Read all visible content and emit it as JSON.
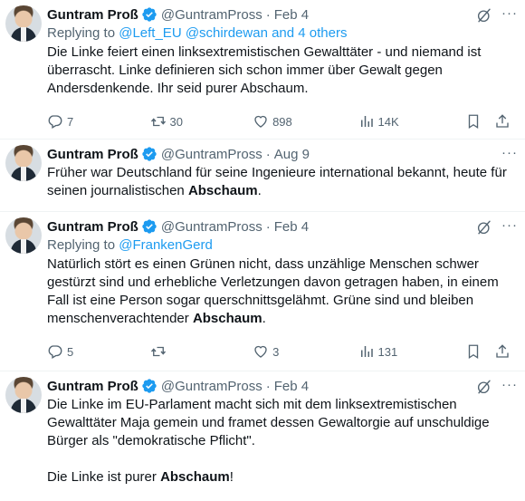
{
  "colors": {
    "accent": "#1d9bf0",
    "muted": "#536471",
    "text": "#0f1419"
  },
  "tweets": [
    {
      "name": "Guntram Proß",
      "handle": "@GuntramPross",
      "date": "Feb 4",
      "reply_prefix": "Replying to",
      "reply_targets": "@Left_EU @schirdewan and 4 others",
      "text": "Die Linke feiert einen linksextremistischen Gewalttäter - und niemand ist überrascht. Linke definieren sich schon immer über Gewalt gegen Andersdenkende. Ihr seid purer Abschaum.",
      "replies": "7",
      "reposts": "30",
      "likes": "898",
      "views": "14K"
    },
    {
      "name": "Guntram Proß",
      "handle": "@GuntramPross",
      "date": "Aug 9",
      "text_before": "Früher war Deutschland für seine Ingenieure international bekannt, heute für seinen journalistischen ",
      "text_bold": "Abschaum",
      "text_after": "."
    },
    {
      "name": "Guntram Proß",
      "handle": "@GuntramPross",
      "date": "Feb 4",
      "reply_prefix": "Replying to",
      "reply_targets": "@FrankenGerd",
      "text_before": "Natürlich stört es einen Grünen nicht, dass unzählige Menschen schwer gestürzt sind und erhebliche Verletzungen davon getragen haben, in einem Fall ist eine Person sogar querschnittsgelähmt. Grüne sind und bleiben menschenverachtender ",
      "text_bold": "Abschaum",
      "text_after": ".",
      "replies": "5",
      "reposts": "",
      "likes": "3",
      "views": "131"
    },
    {
      "name": "Guntram Proß",
      "handle": "@GuntramPross",
      "date": "Feb 4",
      "text": "Die Linke im EU-Parlament macht sich mit dem linksextremistischen Gewalttäter Maja gemein und framet dessen Gewaltorgie auf unschuldige Bürger als \"demokratische Pflicht\".",
      "text2_before": "Die Linke ist purer ",
      "text2_bold": "Abschaum",
      "text2_after": "!"
    }
  ],
  "icons": {
    "verified": "verified-badge-icon",
    "grok": "grok-icon",
    "reply": "reply-icon",
    "repost": "repost-icon",
    "like": "heart-icon",
    "views": "views-icon",
    "bookmark": "bookmark-icon",
    "share": "share-icon"
  }
}
